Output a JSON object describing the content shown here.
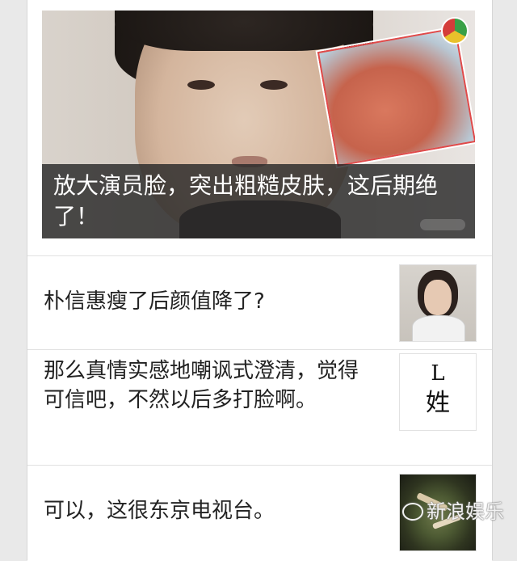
{
  "hero": {
    "caption": "放大演员脸，突出粗糙皮肤，这后期绝了！"
  },
  "items": [
    {
      "text": "朴信惠瘦了后颜值降了?"
    },
    {
      "text": "那么真情实感地嘲讽式澄清，觉得可信吧，不然以后多打脸啊。",
      "thumb_line1": "L",
      "thumb_line2": "姓"
    },
    {
      "text": "可以，这很东京电视台。"
    }
  ],
  "watermark": {
    "text": "新浪娱乐"
  },
  "colors": {
    "caption_bg": "#282828",
    "accent_border": "#e04a4a",
    "page_bg": "#e9e9e9"
  }
}
